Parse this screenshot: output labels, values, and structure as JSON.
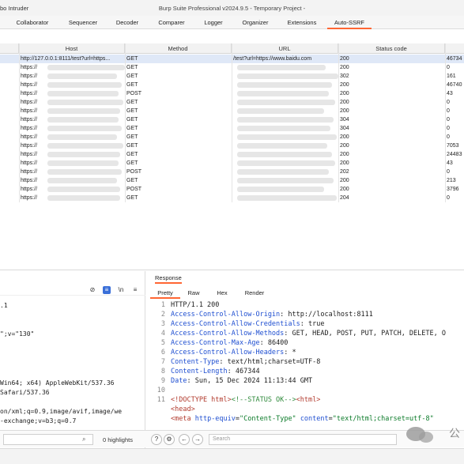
{
  "window": {
    "left_title": "bo Intruder",
    "center_title": "Burp Suite Professional v2024.9.5 - Temporary Project -"
  },
  "tabs": [
    {
      "label": "Collaborator"
    },
    {
      "label": "Sequencer"
    },
    {
      "label": "Decoder"
    },
    {
      "label": "Comparer"
    },
    {
      "label": "Logger"
    },
    {
      "label": "Organizer"
    },
    {
      "label": "Extensions"
    },
    {
      "label": "Auto-SSRF",
      "active": true
    }
  ],
  "table": {
    "headers": [
      "Host",
      "Method",
      "URL",
      "Status code"
    ],
    "rows": [
      {
        "host": "http://127.0.0.1:8111/test?url=https...",
        "method": "GET",
        "url": "/test?url=https://www.baidu.com",
        "status": "200",
        "length": "46734",
        "selected": true
      },
      {
        "host": "https://",
        "method": "GET",
        "url": "",
        "status": "200",
        "length": "0"
      },
      {
        "host": "https://",
        "method": "GET",
        "url": "",
        "status": "302",
        "length": "161"
      },
      {
        "host": "https://",
        "method": "GET",
        "url": "",
        "status": "200",
        "length": "46740"
      },
      {
        "host": "https://",
        "method": "POST",
        "url": "",
        "status": "200",
        "length": "43"
      },
      {
        "host": "https://",
        "method": "GET",
        "url": "",
        "status": "200",
        "length": "0"
      },
      {
        "host": "https://",
        "method": "GET",
        "url": "",
        "status": "200",
        "length": "0"
      },
      {
        "host": "https://",
        "method": "GET",
        "url": "",
        "status": "304",
        "length": "0"
      },
      {
        "host": "https://",
        "method": "GET",
        "url": "",
        "status": "304",
        "length": "0"
      },
      {
        "host": "https://",
        "method": "GET",
        "url": "",
        "status": "200",
        "length": "0"
      },
      {
        "host": "https://",
        "method": "GET",
        "url": "",
        "status": "200",
        "length": "7053"
      },
      {
        "host": "https://",
        "method": "GET",
        "url": "",
        "status": "200",
        "length": "24483"
      },
      {
        "host": "https://",
        "method": "GET",
        "url": "",
        "status": "200",
        "length": "43"
      },
      {
        "host": "https://",
        "method": "POST",
        "url": "",
        "status": "202",
        "length": "0"
      },
      {
        "host": "https://",
        "method": "GET",
        "url": "",
        "status": "200",
        "length": "213"
      },
      {
        "host": "https://",
        "method": "POST",
        "url": "",
        "status": "200",
        "length": "3796"
      },
      {
        "host": "https://",
        "method": "GET",
        "url": "",
        "status": "204",
        "length": "0"
      }
    ]
  },
  "request": {
    "lines": [
      ".1",
      "\";v=\"130\"",
      "Win64; x64) AppleWebKit/537.36",
      "Safari/537.36",
      "on/xml;q=0.9,image/avif,image/we",
      "-exchange;v=b3;q=0.7"
    ],
    "search_placeholder": "",
    "highlights": "0 highlights"
  },
  "response": {
    "title": "Response",
    "subtabs": [
      "Pretty",
      "Raw",
      "Hex",
      "Render"
    ],
    "lines": [
      {
        "n": "1",
        "parts": [
          [
            "v",
            "HTTP/1.1 200"
          ]
        ]
      },
      {
        "n": "2",
        "parts": [
          [
            "k",
            "Access-Control-Allow-Origin"
          ],
          [
            "v",
            ": http://localhost:8111"
          ]
        ]
      },
      {
        "n": "3",
        "parts": [
          [
            "k",
            "Access-Control-Allow-Credentials"
          ],
          [
            "v",
            ": true"
          ]
        ]
      },
      {
        "n": "4",
        "parts": [
          [
            "k",
            "Access-Control-Allow-Methods"
          ],
          [
            "v",
            ": GET, HEAD, POST, PUT, PATCH, DELETE, O"
          ]
        ]
      },
      {
        "n": "5",
        "parts": [
          [
            "k",
            "Access-Control-Max-Age"
          ],
          [
            "v",
            ": 86400"
          ]
        ]
      },
      {
        "n": "6",
        "parts": [
          [
            "k",
            "Access-Control-Allow-Headers"
          ],
          [
            "v",
            ": *"
          ]
        ]
      },
      {
        "n": "7",
        "parts": [
          [
            "k",
            "Content-Type"
          ],
          [
            "v",
            ": text/html;charset=UTF-8"
          ]
        ]
      },
      {
        "n": "8",
        "parts": [
          [
            "k",
            "Content-Length"
          ],
          [
            "v",
            ": 467344"
          ]
        ]
      },
      {
        "n": "9",
        "parts": [
          [
            "k",
            "Date"
          ],
          [
            "v",
            ": Sun, 15 Dec 2024 11:13:44 GMT"
          ]
        ]
      },
      {
        "n": "10",
        "parts": []
      },
      {
        "n": "11",
        "parts": [
          [
            "tag",
            "<!DOCTYPE html>"
          ],
          [
            "cmt",
            "<!--STATUS OK-->"
          ],
          [
            "tag",
            "<html>"
          ]
        ]
      },
      {
        "n": "",
        "parts": [
          [
            "tag",
            "  <head>"
          ]
        ]
      },
      {
        "n": "",
        "parts": [
          [
            "tag",
            "    <meta "
          ],
          [
            "attr",
            "http-equiv"
          ],
          [
            "v",
            "="
          ],
          [
            "str",
            "\"Content-Type\""
          ],
          [
            "v",
            " "
          ],
          [
            "attr",
            "content"
          ],
          [
            "v",
            "="
          ],
          [
            "str",
            "\"text/html;charset=utf-8\""
          ]
        ]
      }
    ],
    "search_placeholder": "Search"
  },
  "colors": {
    "accent": "#ff6633",
    "selected_row": "#dfe8f7"
  }
}
